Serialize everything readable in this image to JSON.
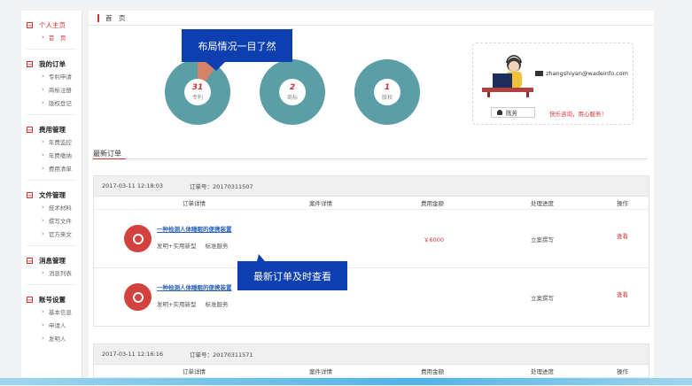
{
  "sidebar": {
    "sections": [
      {
        "title": "个人主页",
        "items": [
          "首　页"
        ]
      },
      {
        "title": "我的订单",
        "items": [
          "专利申请",
          "商标注册",
          "版权登记"
        ]
      },
      {
        "title": "费用管理",
        "items": [
          "年费监控",
          "年费缴纳",
          "费用清单"
        ]
      },
      {
        "title": "文件管理",
        "items": [
          "技术材料",
          "撰写文件",
          "官方来文"
        ]
      },
      {
        "title": "消息管理",
        "items": [
          "消息列表"
        ]
      },
      {
        "title": "账号设置",
        "items": [
          "基本信息",
          "申请人",
          "发明人"
        ]
      }
    ]
  },
  "breadcrumb": "首　页",
  "stats": [
    {
      "num": "31",
      "label": "专利",
      "fraction": 0.1,
      "color": "#5b9ea6",
      "accent": "#d4826a"
    },
    {
      "num": "2",
      "label": "商标",
      "fraction": 0,
      "color": "#5b9ea6",
      "accent": "#d4826a"
    },
    {
      "num": "1",
      "label": "版权",
      "fraction": 0,
      "color": "#5b9ea6",
      "accent": "#d4826a"
    }
  ],
  "tooltips": {
    "overview": "布局情况一目了然",
    "orders": "最新订单及时查看"
  },
  "service": {
    "email": "zhangshiyan@wadeinfo.com",
    "name": "陈芳",
    "slogan": "快乐咨询，用心服务！"
  },
  "orders_title": "最新订单",
  "columns": [
    "订单详情",
    "案件详情",
    "费用金额",
    "处理进度",
    "操作"
  ],
  "orders": [
    {
      "time": "2017-03-11 12:18:03",
      "no_label": "订单号：",
      "no": "20170311507",
      "rows": [
        {
          "title": "一种检测人体睡眠的便携装置",
          "type": "发明+实用新型",
          "service": "标准服务",
          "amount": "￥6000",
          "progress": "立案撰写",
          "action": "查看"
        },
        {
          "title": "一种检测人体睡眠的便携装置",
          "type": "发明+实用新型",
          "service": "标准服务",
          "amount": "",
          "progress": "立案撰写",
          "action": "查看"
        }
      ]
    },
    {
      "time": "2017-03-11 12:16:16",
      "no_label": "订单号：",
      "no": "20170311571",
      "rows": []
    }
  ],
  "colors": {
    "accent": "#cc3333",
    "donut": "#5b9ea6",
    "donut_accent": "#d4826a",
    "tooltip": "#0d3fb0"
  }
}
